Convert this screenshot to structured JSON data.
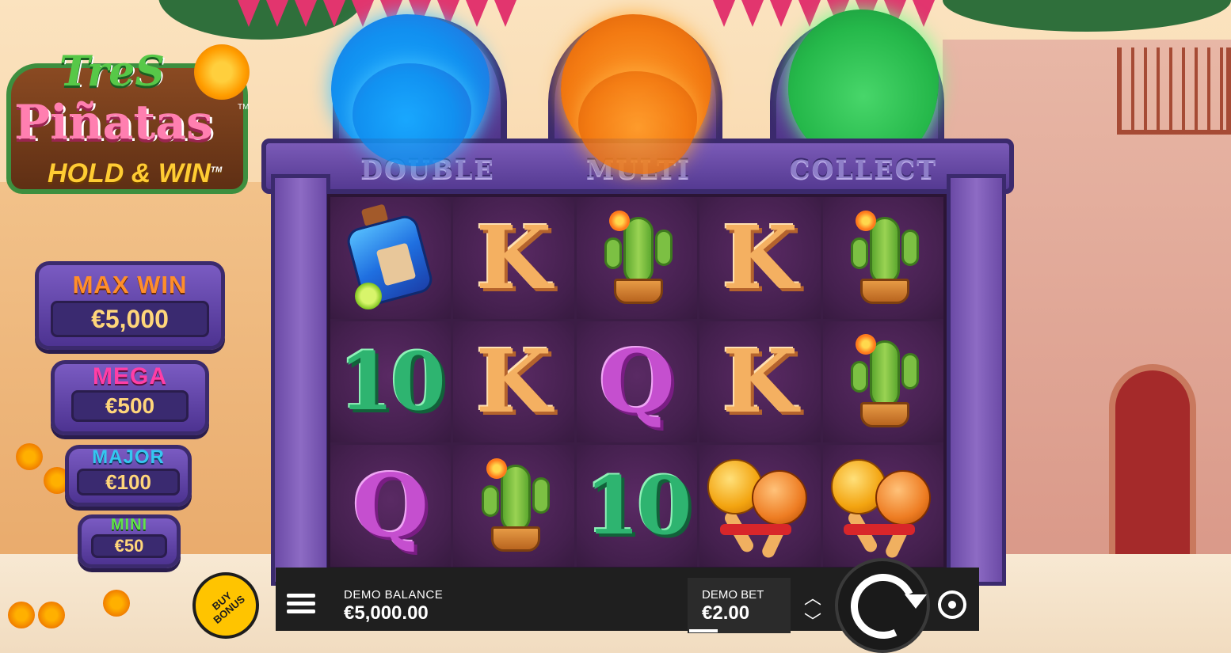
{
  "logo": {
    "line1": "TreS",
    "line2": "Piñatas",
    "trademark": "TM",
    "line3": "HOLD & WIN",
    "line3_tm": "TM"
  },
  "jackpots": [
    {
      "label": "MAX WIN",
      "value": "€5,000",
      "color": "#ff8e2b"
    },
    {
      "label": "MEGA",
      "value": "€500",
      "color": "#ff3ea6"
    },
    {
      "label": "MAJOR",
      "value": "€100",
      "color": "#35c6f0"
    },
    {
      "label": "MINI",
      "value": "€50",
      "color": "#62e34a"
    }
  ],
  "modes": [
    {
      "label": "DOUBLE",
      "pinata_color": "#1190f0"
    },
    {
      "label": "MULTI",
      "pinata_color": "#f37a12"
    },
    {
      "label": "COLLECT",
      "pinata_color": "#25b84a"
    }
  ],
  "reels": [
    [
      "potion-icon",
      "K",
      "cactus-icon",
      "K",
      "cactus-icon"
    ],
    [
      "10",
      "K",
      "Q",
      "K",
      "cactus-icon"
    ],
    [
      "Q",
      "cactus-icon",
      "10",
      "maracas-icon",
      "maracas-icon"
    ]
  ],
  "controls": {
    "buy_bonus_label": "BUY BONUS",
    "balance_label": "DEMO BALANCE",
    "balance_value": "€5,000.00",
    "bet_label": "DEMO BET",
    "bet_value": "€2.00",
    "menu_icon": "hamburger-menu-icon",
    "spin_icon": "spin-icon",
    "autoplay_icon": "autoplay-icon"
  }
}
